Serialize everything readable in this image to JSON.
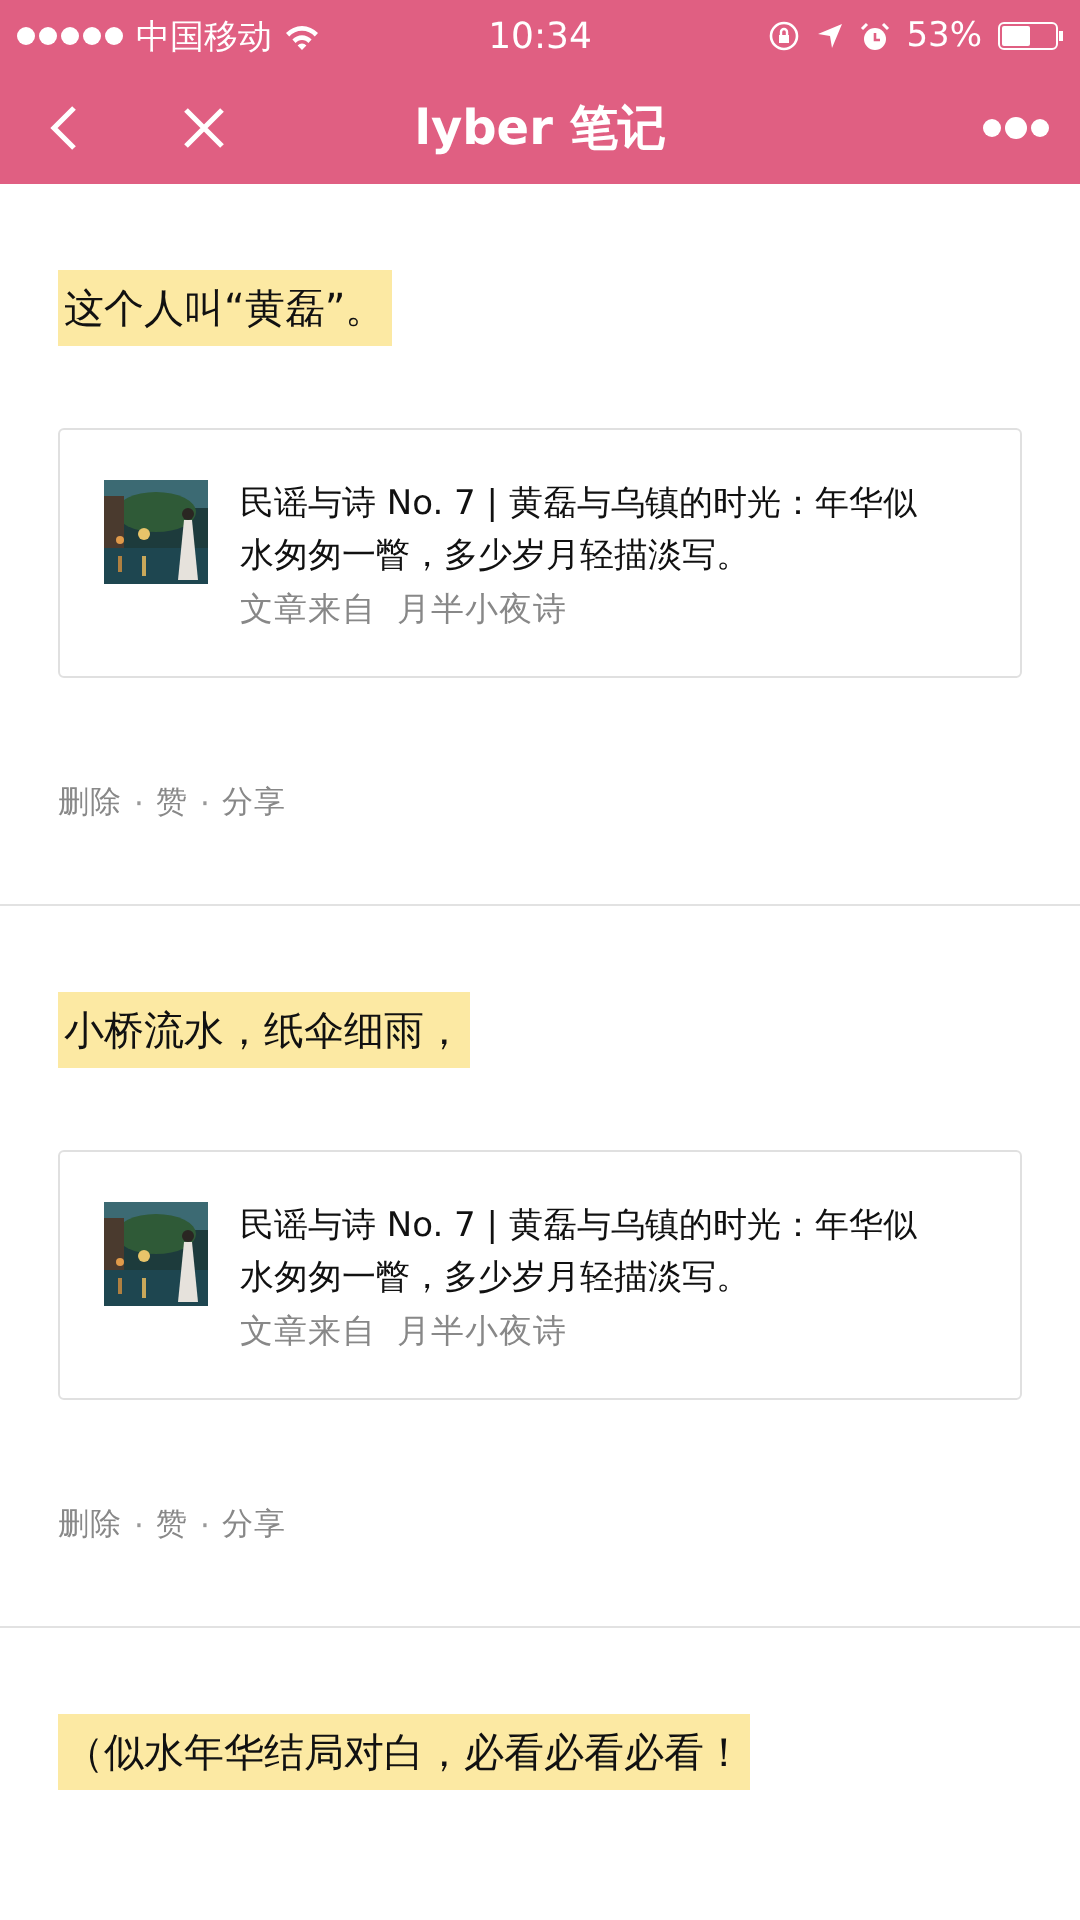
{
  "status_bar": {
    "carrier": "中国移动",
    "time": "10:34",
    "battery": "53%"
  },
  "nav_bar": {
    "title": "lyber 笔记"
  },
  "posts": [
    {
      "quote": "这个人叫“黄磊”。",
      "article": {
        "kind": "picture",
        "title": "民谣与诗 No. 7 | 黄磊与乌镇的时光：年华似水匆匆一瞥，多少岁月轻描淡写。",
        "source": "文章来自  月半小夜诗"
      },
      "actions": [
        "删除",
        "赞",
        "分享"
      ],
      "separator": "·"
    },
    {
      "quote": "小桥流水，纸伞细雨，",
      "article": {
        "kind": "picture",
        "title": "民谣与诗 No. 7 | 黄磊与乌镇的时光：年华似水匆匆一瞥，多少岁月轻描淡写。",
        "source": "文章来自  月半小夜诗"
      },
      "actions": [
        "删除",
        "赞",
        "分享"
      ],
      "separator": "·"
    },
    {
      "quote": "（似水年华结局对白，必看必看必看！"
    }
  ]
}
